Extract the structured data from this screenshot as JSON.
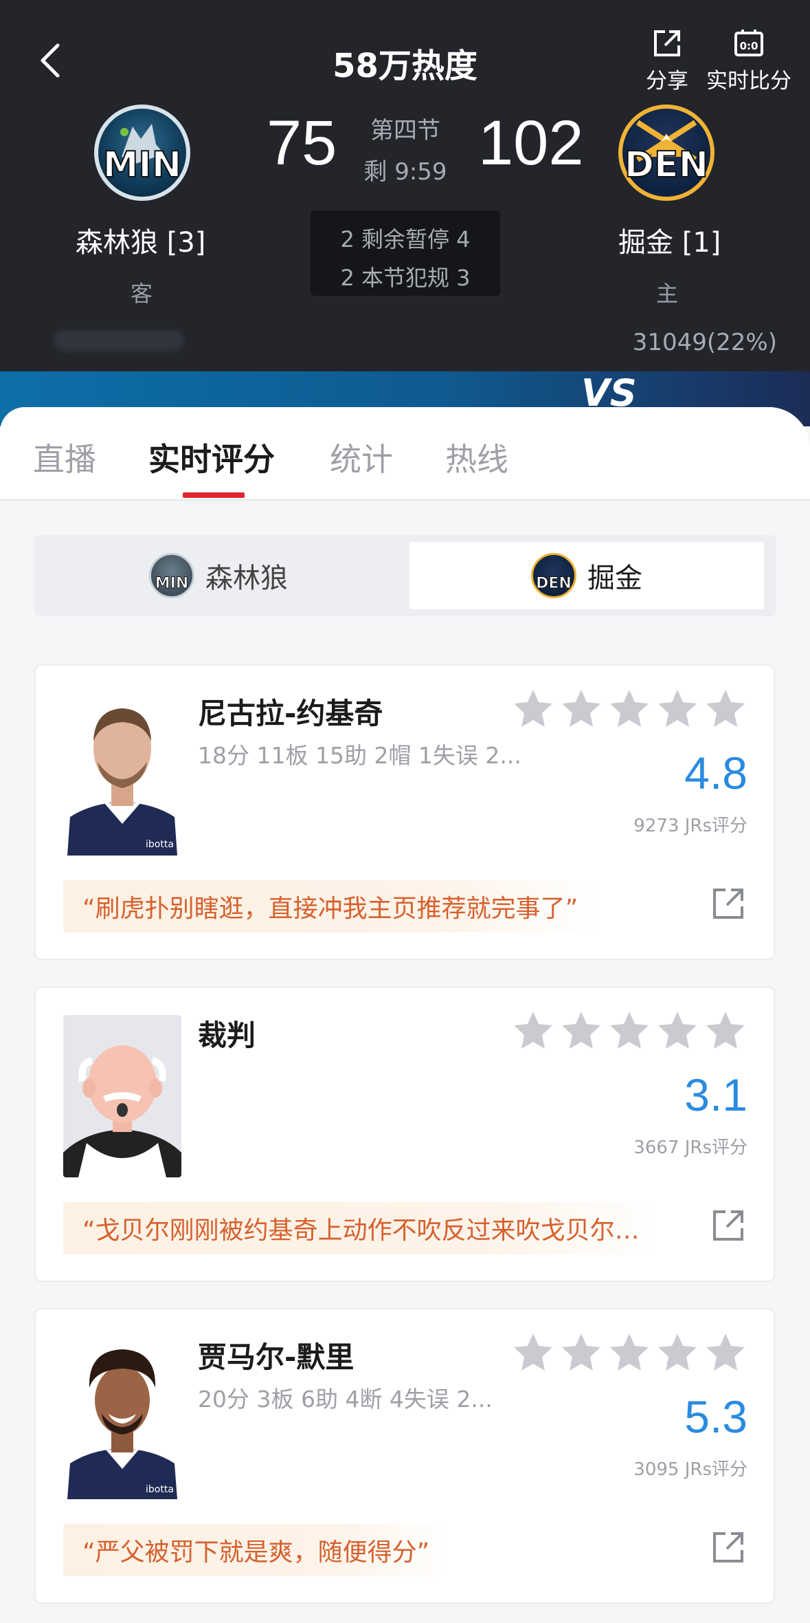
{
  "header": {
    "heat": "58万热度",
    "share_label": "分享",
    "live_score_label": "实时比分",
    "away": {
      "abbr": "MIN",
      "score": "75",
      "name": "森林狼 [3]",
      "role": "客"
    },
    "home": {
      "abbr": "DEN",
      "score": "102",
      "name": "掘金 [1]",
      "role": "主",
      "votes": "31049(22%)"
    },
    "period": "第四节",
    "time_left": "剩 9:59",
    "timeouts": "2 剩余暂停 4",
    "fouls": "2 本节犯规 3",
    "vs": "VS"
  },
  "tabs": [
    {
      "label": "直播"
    },
    {
      "label": "实时评分"
    },
    {
      "label": "统计"
    },
    {
      "label": "热线"
    }
  ],
  "team_switch": {
    "min": {
      "abbr": "MIN",
      "label": "森林狼"
    },
    "den": {
      "abbr": "DEN",
      "label": "掘金"
    }
  },
  "players": [
    {
      "name": "尼古拉-约基奇",
      "stats": "18分 11板 15助 2帽 1失误 2...",
      "rating": "4.8",
      "votes": "9273 JRs评分",
      "comment": "“刷虎扑别瞎逛，直接冲我主页推荐就完事了”",
      "jersey_text": "ibotta"
    },
    {
      "name": "裁判",
      "stats": "",
      "rating": "3.1",
      "votes": "3667 JRs评分",
      "comment": "“戈贝尔刚刚被约基奇上动作不吹反过来吹戈贝尔…",
      "jersey_text": ""
    },
    {
      "name": "贾马尔-默里",
      "stats": "20分 3板 6助 4断 4失误 2...",
      "rating": "5.3",
      "votes": "3095 JRs评分",
      "comment": "“严父被罚下就是爽，随便得分”",
      "jersey_text": "ibotta"
    }
  ],
  "colors": {
    "accent_red": "#e1252e",
    "rating_blue": "#2a8be0",
    "comment_orange": "#d5612e",
    "header_bg": "#23252b"
  }
}
